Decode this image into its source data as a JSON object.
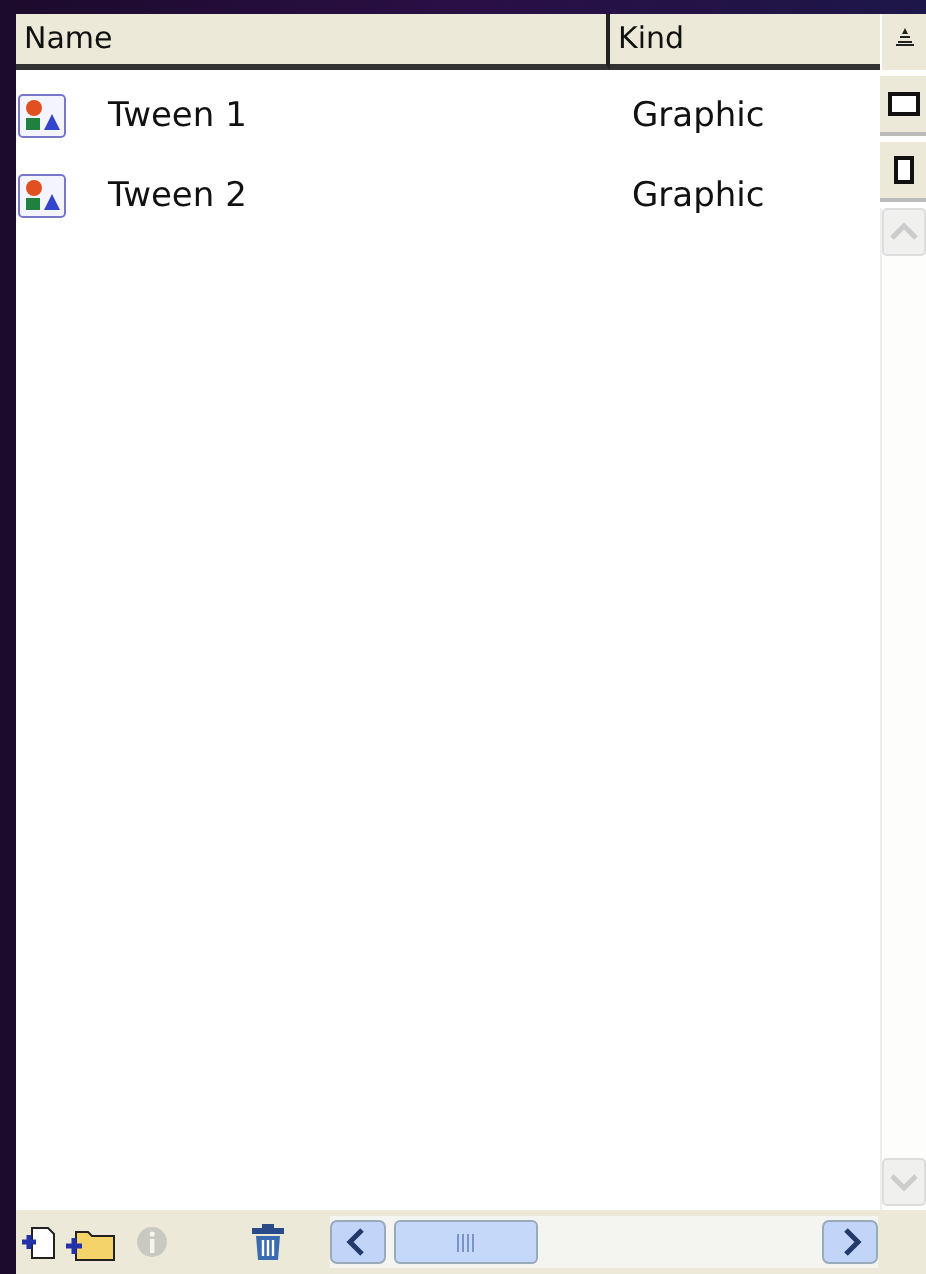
{
  "columns": [
    {
      "label": "Name"
    },
    {
      "label": "Kind"
    }
  ],
  "rows": [
    {
      "name": "Tween 1",
      "kind": "Graphic"
    },
    {
      "name": "Tween 2",
      "kind": "Graphic"
    }
  ],
  "toolbar": [
    {
      "kind": "new-symbol",
      "disabled": false
    },
    {
      "kind": "new-folder",
      "disabled": false
    },
    {
      "kind": "properties",
      "disabled": true
    },
    {
      "kind": "delete",
      "disabled": false
    }
  ]
}
